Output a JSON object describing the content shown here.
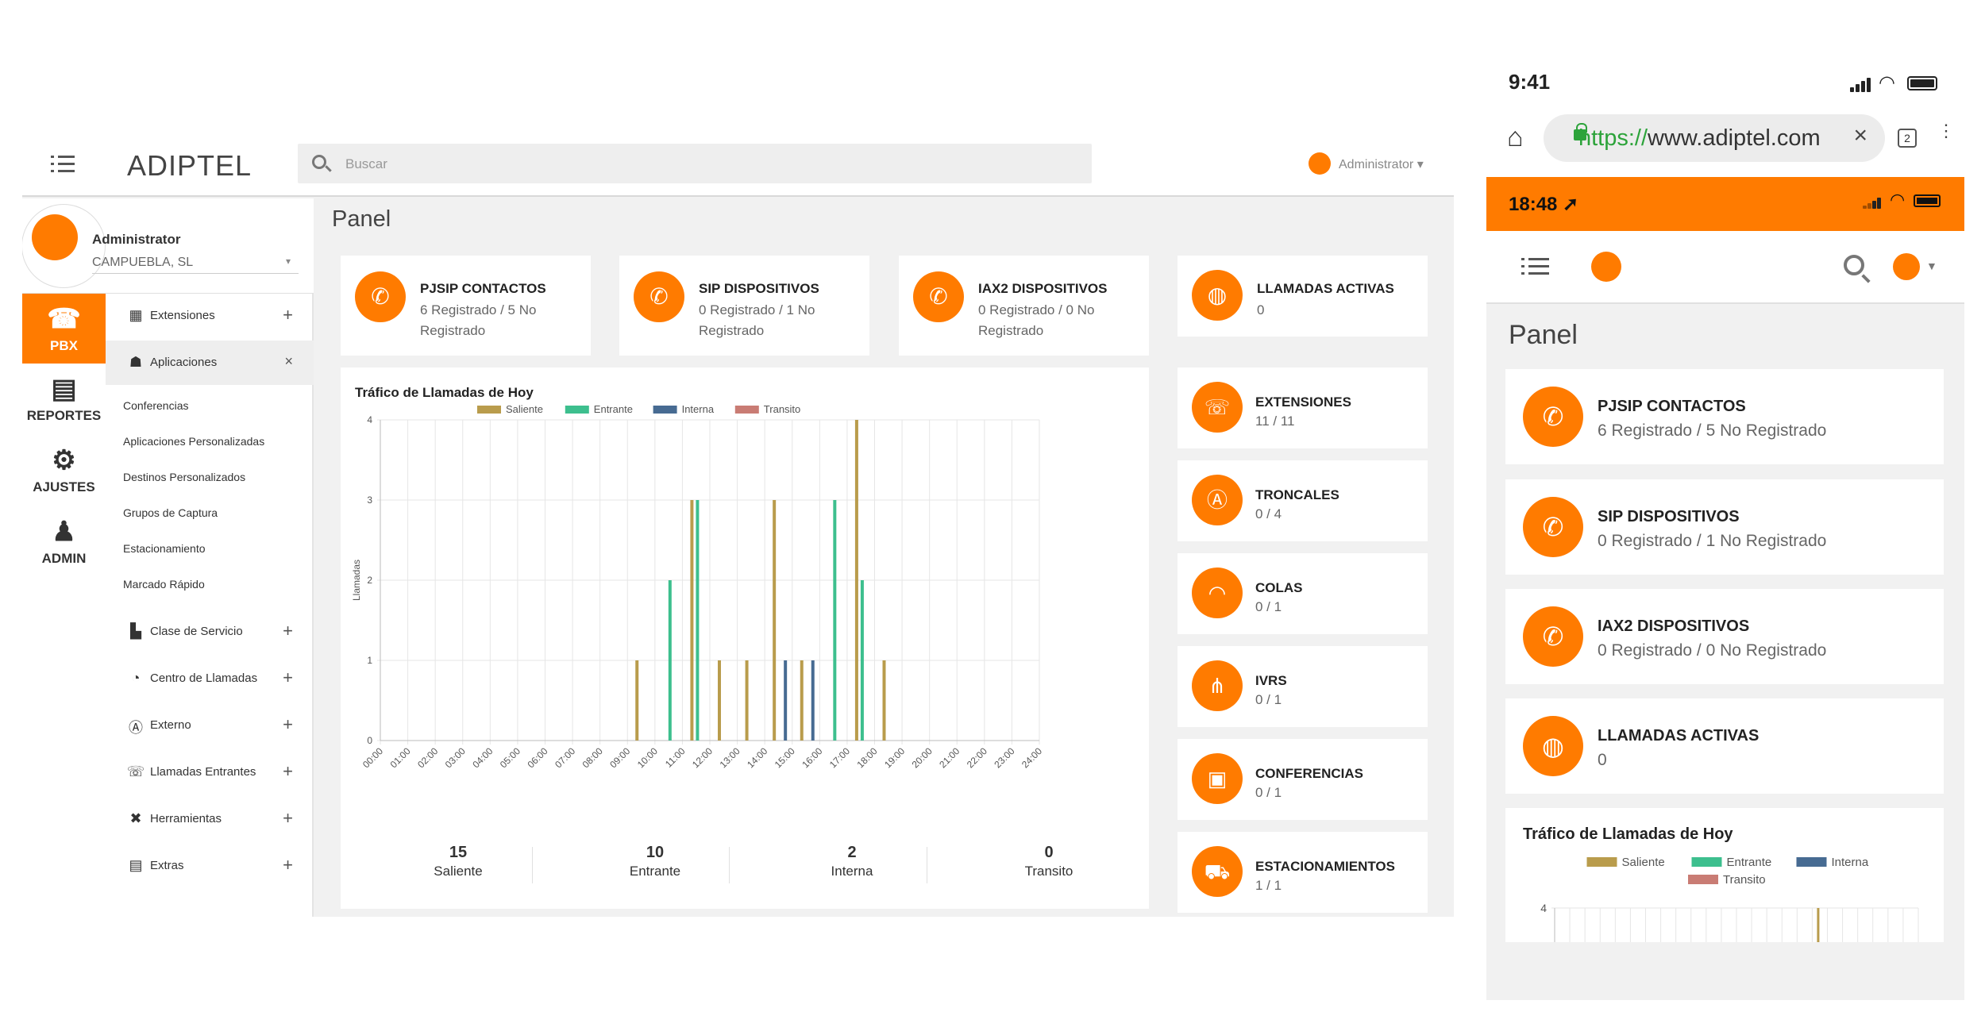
{
  "desktop": {
    "brand": "ADIPTEL",
    "search": {
      "placeholder": "Buscar"
    },
    "user_menu": "Administrator ▾",
    "profile": {
      "name": "Administrator",
      "company": "CAMPUEBLA, SL"
    },
    "rail": [
      {
        "label": "PBX",
        "icon": "phone-icon"
      },
      {
        "label": "REPORTES",
        "icon": "documents-icon"
      },
      {
        "label": "AJUSTES",
        "icon": "gears-icon"
      },
      {
        "label": "ADMIN",
        "icon": "user-icon"
      }
    ],
    "menu": {
      "extensiones": "Extensiones",
      "aplicaciones": "Aplicaciones",
      "aplicaciones_sub": [
        "Conferencias",
        "Aplicaciones Personalizadas",
        "Destinos Personalizados",
        "Grupos de Captura",
        "Estacionamiento",
        "Marcado Rápido"
      ],
      "clase_servicio": "Clase de Servicio",
      "centro_llamadas": "Centro de Llamadas",
      "externo": "Externo",
      "llamadas_entrantes": "Llamadas Entrantes",
      "herramientas": "Herramientas",
      "extras": "Extras"
    },
    "panel_title": "Panel",
    "cards": [
      {
        "title": "PJSIP CONTACTOS",
        "sub": "6 Registrado / 5 No Registrado"
      },
      {
        "title": "SIP DISPOSITIVOS",
        "sub": "0 Registrado / 1 No Registrado"
      },
      {
        "title": "IAX2 DISPOSITIVOS",
        "sub": "0 Registrado / 0 No Registrado"
      },
      {
        "title": "LLAMADAS ACTIVAS",
        "sub": "0"
      }
    ],
    "right_cards": [
      {
        "title": "EXTENSIONES",
        "sub": "11 / 11",
        "icon": "phone-ring-icon"
      },
      {
        "title": "TRONCALES",
        "sub": "0 / 4",
        "icon": "antenna-icon"
      },
      {
        "title": "COLAS",
        "sub": "0 / 1",
        "icon": "headset-icon"
      },
      {
        "title": "IVRS",
        "sub": "0 / 1",
        "icon": "sitemap-icon"
      },
      {
        "title": "CONFERENCIAS",
        "sub": "0 / 1",
        "icon": "presentation-icon"
      },
      {
        "title": "ESTACIONAMIENTOS",
        "sub": "1 / 1",
        "icon": "car-icon"
      }
    ],
    "chart_title": "Tráfico de Llamadas de Hoy",
    "stats": [
      {
        "value": "15",
        "label": "Saliente"
      },
      {
        "value": "10",
        "label": "Entrante"
      },
      {
        "value": "2",
        "label": "Interna"
      },
      {
        "value": "0",
        "label": "Transito"
      }
    ]
  },
  "phone": {
    "time": "9:41",
    "url_scheme": "https://",
    "url_host": "www.adiptel.com",
    "tab_count": "2",
    "inner_time": "18:48",
    "panel_title": "Panel",
    "cards": [
      {
        "title": "PJSIP CONTACTOS",
        "sub": "6 Registrado / 5 No Registrado"
      },
      {
        "title": "SIP DISPOSITIVOS",
        "sub": "0 Registrado / 1 No Registrado"
      },
      {
        "title": "IAX2 DISPOSITIVOS",
        "sub": "0 Registrado / 0 No Registrado"
      },
      {
        "title": "LLAMADAS ACTIVAS",
        "sub": "0"
      }
    ],
    "chart_title": "Tráfico de Llamadas de Hoy"
  },
  "colors": {
    "accent": "#ff7b00",
    "saliente": "#b99c4c",
    "entrante": "#3dbf8e",
    "interna": "#476b92",
    "transito": "#c97c74"
  },
  "chart_data": {
    "type": "bar",
    "title": "Tráfico de Llamadas de Hoy",
    "xlabel": "",
    "ylabel": "Llamadas",
    "ylim": [
      0,
      4
    ],
    "yticks": [
      0,
      1,
      2,
      3,
      4
    ],
    "categories": [
      "00:00",
      "01:00",
      "02:00",
      "03:00",
      "04:00",
      "05:00",
      "06:00",
      "07:00",
      "08:00",
      "09:00",
      "10:00",
      "11:00",
      "12:00",
      "13:00",
      "14:00",
      "15:00",
      "16:00",
      "17:00",
      "18:00",
      "19:00",
      "20:00",
      "21:00",
      "22:00",
      "23:00",
      "24:00"
    ],
    "legend_position": "top",
    "grid": true,
    "series": [
      {
        "name": "Saliente",
        "color": "#b99c4c",
        "values": [
          0,
          0,
          0,
          0,
          0,
          0,
          0,
          0,
          0,
          1,
          0,
          3,
          1,
          1,
          3,
          1,
          0,
          4,
          1,
          0,
          0,
          0,
          0,
          0,
          0
        ]
      },
      {
        "name": "Entrante",
        "color": "#3dbf8e",
        "values": [
          0,
          0,
          0,
          0,
          0,
          0,
          0,
          0,
          0,
          0,
          2,
          3,
          0,
          0,
          0,
          0,
          3,
          2,
          0,
          0,
          0,
          0,
          0,
          0,
          0
        ]
      },
      {
        "name": "Interna",
        "color": "#476b92",
        "values": [
          0,
          0,
          0,
          0,
          0,
          0,
          0,
          0,
          0,
          0,
          0,
          0,
          0,
          0,
          1,
          1,
          0,
          0,
          0,
          0,
          0,
          0,
          0,
          0,
          0
        ]
      },
      {
        "name": "Transito",
        "color": "#c97c74",
        "values": [
          0,
          0,
          0,
          0,
          0,
          0,
          0,
          0,
          0,
          0,
          0,
          0,
          0,
          0,
          0,
          0,
          0,
          0,
          0,
          0,
          0,
          0,
          0,
          0,
          0
        ]
      }
    ]
  }
}
